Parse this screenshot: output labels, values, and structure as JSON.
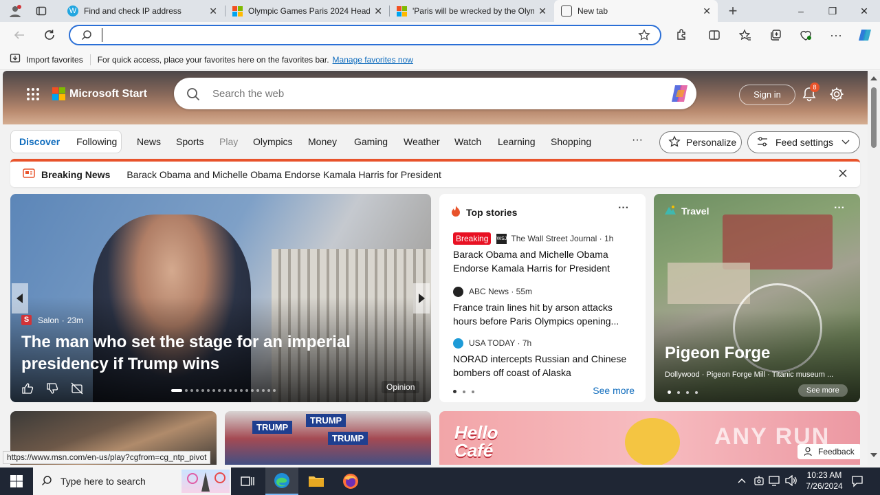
{
  "browser": {
    "tabs": [
      {
        "title": "Find and check IP address"
      },
      {
        "title": "Olympic Games Paris 2024 Headl"
      },
      {
        "title": "'Paris will be wrecked by the Olym"
      },
      {
        "title": "New tab"
      }
    ],
    "new_tab_symbol": "+",
    "window_controls": {
      "minimize": "–",
      "maximize": "❐",
      "close": "✕"
    },
    "address": {
      "value": "",
      "placeholder": ""
    },
    "favorites_bar": {
      "import_label": "Import favorites",
      "hint": "For quick access, place your favorites here on the favorites bar.",
      "manage_link": "Manage favorites now"
    },
    "status_url": "https://www.msn.com/en-us/play?cgfrom=cg_ntp_pivot"
  },
  "msn": {
    "brand": "Microsoft Start",
    "search_placeholder": "Search the web",
    "sign_in": "Sign in",
    "notification_count": "8",
    "nav": {
      "discover": "Discover",
      "following": "Following",
      "items": [
        "News",
        "Sports",
        "Play",
        "Olympics",
        "Money",
        "Gaming",
        "Weather",
        "Watch",
        "Learning",
        "Shopping"
      ],
      "more": "···",
      "personalize": "Personalize",
      "feed_settings": "Feed settings"
    },
    "breaking": {
      "label": "Breaking News",
      "headline": "Barack Obama and Michelle Obama Endorse Kamala Harris for President"
    },
    "main_story": {
      "source": "Salon",
      "age": "23m",
      "headline": "The man who set the stage for an imperial presidency if Trump wins",
      "tag": "Opinion",
      "slides": 18,
      "active_slide": 1
    },
    "top_stories": {
      "title": "Top stories",
      "items": [
        {
          "badge": "Breaking",
          "source": "The Wall Street Journal · 1h",
          "headline": "Barack Obama and Michelle Obama Endorse Kamala Harris for President"
        },
        {
          "source": "ABC News · 55m",
          "headline": "France train lines hit by arson attacks hours before Paris Olympics opening..."
        },
        {
          "source": "USA TODAY · 7h",
          "headline": "NORAD intercepts Russian and Chinese bombers off coast of Alaska"
        }
      ],
      "see_more": "See more"
    },
    "travel": {
      "label": "Travel",
      "title": "Pigeon Forge",
      "subtitle": "Dollywood · Pigeon Forge Mill · Titanic museum ...",
      "see_more": "See more"
    },
    "bottom_cards": {
      "cafe_title": "Hello Café",
      "sign_word": "TRUMP"
    },
    "watermark": "ANY RUN",
    "feedback": "Feedback"
  },
  "taskbar": {
    "search_placeholder": "Type here to search",
    "time": "10:23 AM",
    "date": "7/26/2024"
  },
  "colors": {
    "accent": "#0f6cbd",
    "breaking_red": "#e81123",
    "taskbar": "#1f2634"
  }
}
